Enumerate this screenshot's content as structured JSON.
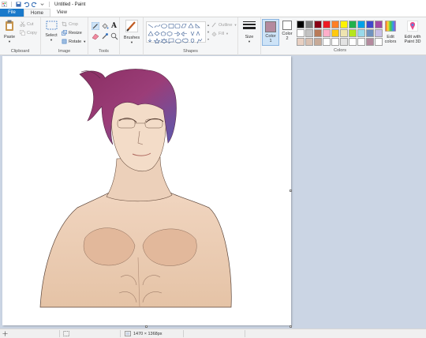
{
  "window": {
    "title": "Untitled - Paint"
  },
  "tabs": [
    {
      "label": "File"
    },
    {
      "label": "Home"
    },
    {
      "label": "View"
    }
  ],
  "ribbon": {
    "clipboard": {
      "paste": "Paste",
      "cut": "Cut",
      "copy": "Copy",
      "group_label": "Clipboard"
    },
    "image": {
      "select": "Select",
      "crop": "Crop",
      "resize": "Resize",
      "rotate": "Rotate",
      "group_label": "Image"
    },
    "tools": {
      "group_label": "Tools",
      "text_tool": "A"
    },
    "brushes": {
      "label": "Brushes"
    },
    "shapes": {
      "outline": "Outline",
      "fill": "Fill",
      "group_label": "Shapes"
    },
    "size": {
      "label": "Size"
    },
    "color1": {
      "label": "Color",
      "number": "1",
      "color": "#b48a9e"
    },
    "color2": {
      "label": "Color",
      "number": "2",
      "color": "#ffffff"
    },
    "colors": {
      "group_label": "Colors",
      "palette": [
        "#000000",
        "#7f7f7f",
        "#880015",
        "#ed1c24",
        "#ff7f27",
        "#fff200",
        "#22b14c",
        "#00a2e8",
        "#3f48cc",
        "#a349a4",
        "#ffffff",
        "#c3c3c3",
        "#b97a57",
        "#ffaec9",
        "#ffc90e",
        "#efe4b0",
        "#b5e61d",
        "#99d9ea",
        "#7092be",
        "#c8bfe7",
        "#e8d0c2",
        "#d9c1b2",
        "#c7aa98",
        "#ffffff",
        "#ffffff",
        "#e3e3e3",
        "#ffffff",
        "#ffffff",
        "#b48a9e",
        "#ffffff"
      ]
    },
    "edit_colors": {
      "line1": "Edit",
      "line2": "colors"
    },
    "paint3d": {
      "line1": "Edit with",
      "line2": "Paint 3D"
    }
  },
  "status": {
    "dimensions": "1470 × 1368px"
  }
}
